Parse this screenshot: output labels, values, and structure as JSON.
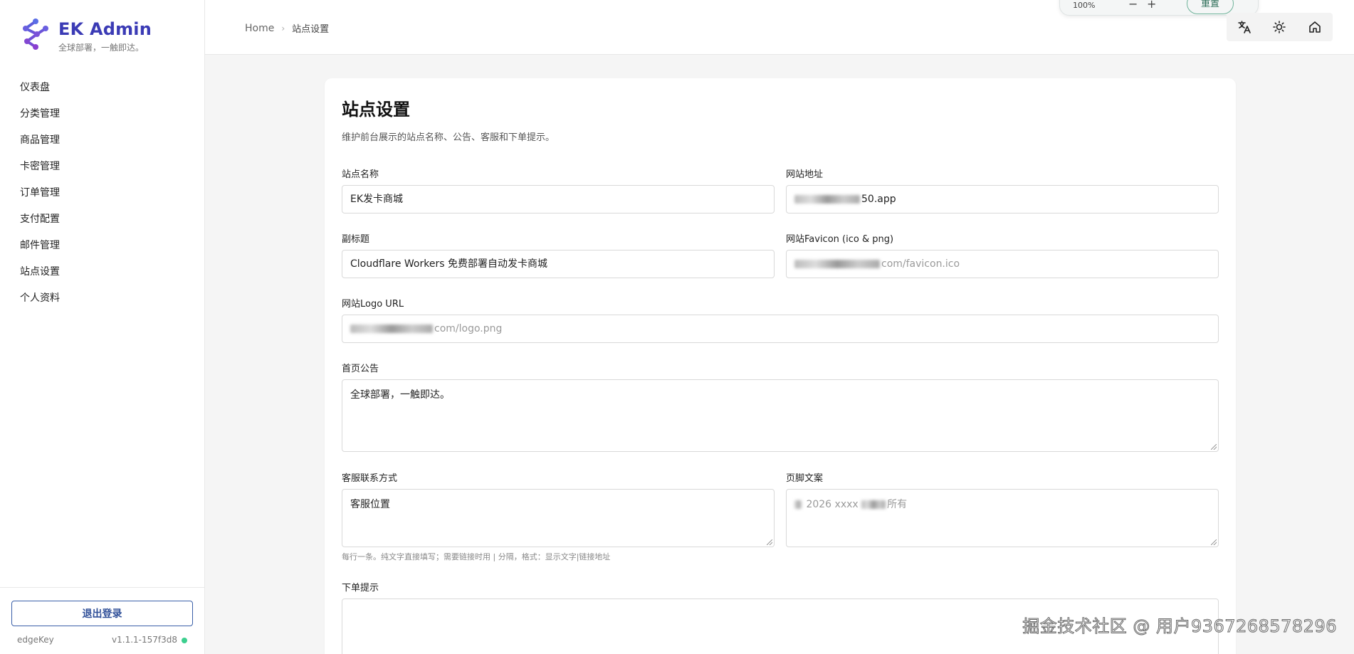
{
  "brand": {
    "title": "EK Admin",
    "subtitle": "全球部署，一触即达。",
    "accent_color": "#3b3bb5"
  },
  "sidebar": {
    "items": [
      {
        "label": "仪表盘"
      },
      {
        "label": "分类管理"
      },
      {
        "label": "商品管理"
      },
      {
        "label": "卡密管理"
      },
      {
        "label": "订单管理"
      },
      {
        "label": "支付配置"
      },
      {
        "label": "邮件管理"
      },
      {
        "label": "站点设置"
      },
      {
        "label": "个人资料"
      }
    ],
    "logout_label": "退出登录",
    "user": "edgeKey",
    "version": "v1.1.1-157f3d8",
    "status_color": "#3ccf8e"
  },
  "header": {
    "breadcrumb": {
      "home": "Home",
      "current": "站点设置"
    },
    "zoom": {
      "level": "100%",
      "minus": "−",
      "plus": "+",
      "reset_label": "重置"
    },
    "actions": {
      "translate_icon": "translate-icon",
      "theme_icon": "sun-icon",
      "home_icon": "home-icon"
    }
  },
  "form": {
    "title": "站点设置",
    "description": "维护前台展示的站点名称、公告、客服和下单提示。",
    "site_name": {
      "label": "站点名称",
      "value": "EK发卡商城"
    },
    "site_url": {
      "label": "网站地址",
      "value": "50.app"
    },
    "subtitle": {
      "label": "副标题",
      "value": "Cloudflare Workers 免费部署自动发卡商城"
    },
    "favicon": {
      "label": "网站Favicon (ico & png)",
      "placeholder": "com/favicon.ico"
    },
    "logo_url": {
      "label": "网站Logo URL",
      "placeholder": "com/logo.png"
    },
    "announcement": {
      "label": "首页公告",
      "value": "全球部署，一触即达。"
    },
    "contact": {
      "label": "客服联系方式",
      "value": "客服位置",
      "hint": "每行一条。纯文字直接填写；需要链接时用 | 分隔，格式：显示文字|链接地址"
    },
    "footer_text": {
      "label": "页脚文案",
      "placeholder_start": "2026 xxxx",
      "placeholder_end": "所有"
    },
    "order_tip": {
      "label": "下单提示",
      "value": ""
    }
  },
  "watermark": "掘金技术社区 @ 用户9367268578296"
}
